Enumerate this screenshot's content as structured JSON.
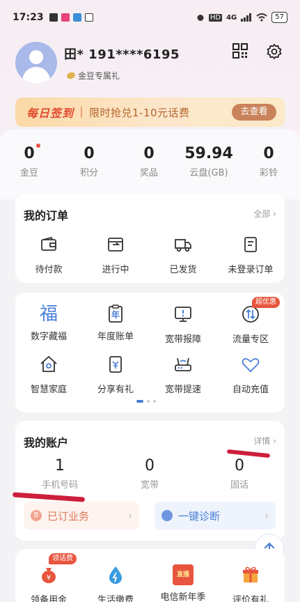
{
  "status_bar": {
    "time": "17:23",
    "network": "4G",
    "battery": "57"
  },
  "profile": {
    "name": "田* 191****6195",
    "gold_tag": "金豆专属礼"
  },
  "signin_banner": {
    "title": "每日签到",
    "text": "限时抢兑1-10元话费",
    "button": "去查看"
  },
  "stats": [
    {
      "value": "0",
      "label": "金豆"
    },
    {
      "value": "0",
      "label": "积分"
    },
    {
      "value": "0",
      "label": "奖品"
    },
    {
      "value": "59.94",
      "label": "云盘(GB)"
    },
    {
      "value": "0",
      "label": "彩铃"
    }
  ],
  "orders": {
    "title": "我的订单",
    "more": "全部 ›",
    "items": [
      {
        "label": "待付款",
        "icon": "wallet-icon"
      },
      {
        "label": "进行中",
        "icon": "inbox-icon"
      },
      {
        "label": "已发货",
        "icon": "truck-icon"
      },
      {
        "label": "未登录订单",
        "icon": "document-icon"
      }
    ]
  },
  "services": {
    "badge": "超优惠",
    "items": [
      {
        "label": "数字藏福",
        "icon": "fu-icon"
      },
      {
        "label": "年度账单",
        "icon": "annual-bill-icon",
        "glyph": "年"
      },
      {
        "label": "宽带报障",
        "icon": "broadband-report-icon"
      },
      {
        "label": "流量专区",
        "icon": "data-traffic-icon"
      },
      {
        "label": "智慧家庭",
        "icon": "smart-home-icon"
      },
      {
        "label": "分享有礼",
        "icon": "share-gift-icon"
      },
      {
        "label": "宽带提速",
        "icon": "router-speed-icon"
      },
      {
        "label": "自动充值",
        "icon": "heart-icon"
      }
    ],
    "fu_glyph": "福"
  },
  "account": {
    "title": "我的账户",
    "more": "详情 ›",
    "items": [
      {
        "value": "1",
        "label": "手机号码"
      },
      {
        "value": "0",
        "label": "宽带"
      },
      {
        "value": "0",
        "label": "固话"
      }
    ],
    "subscribed": "已订业务",
    "diagnose": "一键诊断"
  },
  "bottom_strip": {
    "badge": "领话费",
    "items": [
      {
        "label": "领备用金",
        "icon": "money-bag-icon"
      },
      {
        "label": "生活缴费",
        "icon": "utility-drop-icon"
      },
      {
        "label": "电信新年季",
        "icon": "new-year-icon",
        "tag": "直播"
      },
      {
        "label": "评价有礼",
        "icon": "gift-box-icon"
      }
    ]
  },
  "colors": {
    "accent_blue": "#4a7fd6",
    "badge_red": "#e8553e",
    "icon_dark": "#333333"
  }
}
